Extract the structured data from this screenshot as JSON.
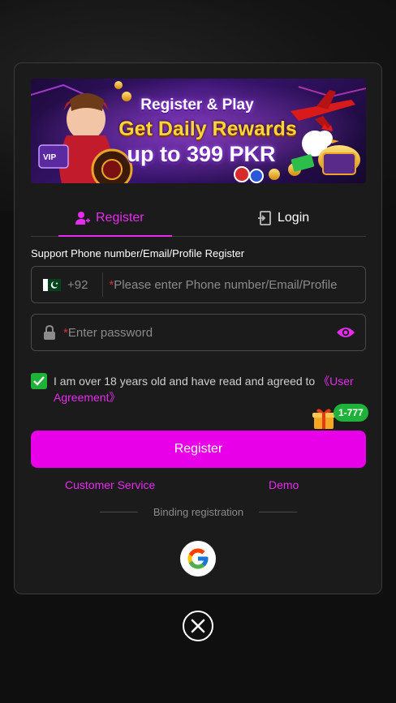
{
  "banner": {
    "line1": "Register & Play",
    "line2": "Get Daily Rewards",
    "line3": "up to 399 PKR",
    "vip_text": "VIP"
  },
  "tabs": [
    {
      "label": "Register",
      "icon": "user-add-icon",
      "active": true
    },
    {
      "label": "Login",
      "icon": "login-icon",
      "active": false
    }
  ],
  "form": {
    "support_text": "Support Phone number/Email/Profile Register",
    "country_code": "+92",
    "country_flag": "pakistan-flag-icon",
    "phone_placeholder": "Please enter Phone number/Email/Profile",
    "password_placeholder": "Enter password",
    "required_mark": "*",
    "agree_text": "I am over 18 years old and have read and agreed to ",
    "agree_link": "《User Agreement》",
    "agree_checked": true
  },
  "promo_badge": "1-777",
  "register_button": "Register",
  "links": {
    "customer_service": "Customer Service",
    "demo": "Demo"
  },
  "binding_label": "Binding registration",
  "colors": {
    "accent": "#e800e8",
    "success": "#1fb23a",
    "background": "#1b1b1c"
  }
}
